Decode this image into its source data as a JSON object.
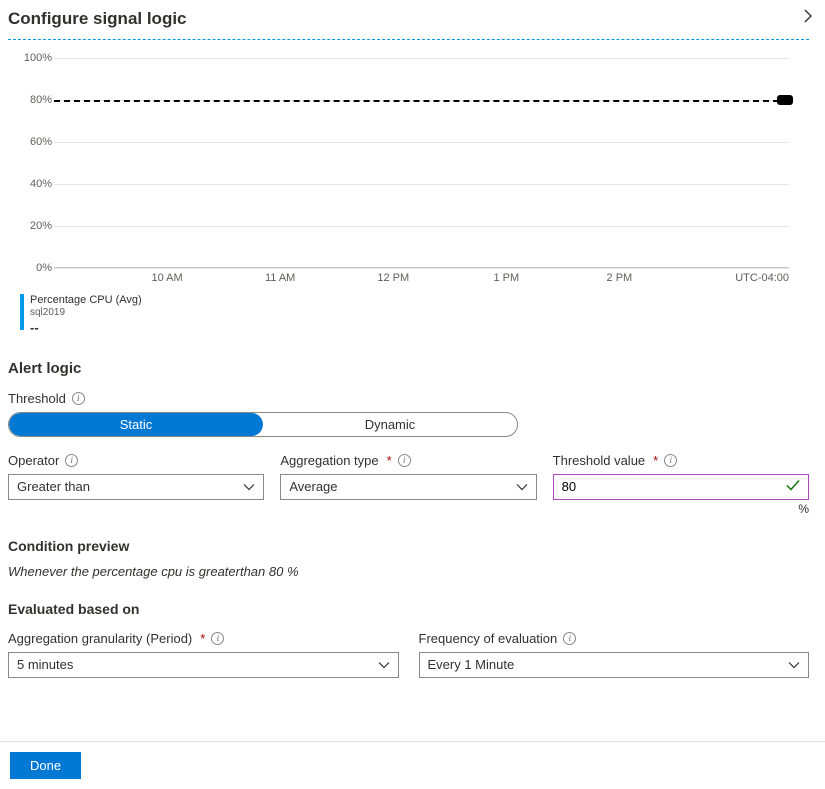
{
  "header": {
    "title": "Configure signal logic"
  },
  "chart_data": {
    "type": "line",
    "title": "",
    "xlabel": "",
    "ylabel": "",
    "ylim": [
      0,
      100
    ],
    "y_unit": "%",
    "y_ticks": [
      0,
      20,
      40,
      60,
      80,
      100
    ],
    "x_ticks": [
      "10 AM",
      "11 AM",
      "12 PM",
      "1 PM",
      "2 PM",
      "UTC-04:00"
    ],
    "threshold": 80,
    "series": [
      {
        "name": "Percentage CPU (Avg)",
        "values": []
      }
    ],
    "legend": {
      "metric": "Percentage CPU (Avg)",
      "resource": "sql2019",
      "value": "--"
    }
  },
  "alertLogic": {
    "section_title": "Alert logic",
    "threshold_label": "Threshold",
    "pills": {
      "static": "Static",
      "dynamic": "Dynamic",
      "active": "static"
    },
    "operator": {
      "label": "Operator",
      "value": "Greater than"
    },
    "aggregation": {
      "label": "Aggregation type",
      "value": "Average"
    },
    "thresholdValue": {
      "label": "Threshold value",
      "value": "80",
      "unit": "%"
    }
  },
  "conditionPreview": {
    "title": "Condition preview",
    "text": "Whenever the percentage cpu is greaterthan 80 %"
  },
  "evaluation": {
    "title": "Evaluated based on",
    "granularity": {
      "label": "Aggregation granularity (Period)",
      "value": "5 minutes"
    },
    "frequency": {
      "label": "Frequency of evaluation",
      "value": "Every 1 Minute"
    }
  },
  "footer": {
    "done": "Done"
  }
}
